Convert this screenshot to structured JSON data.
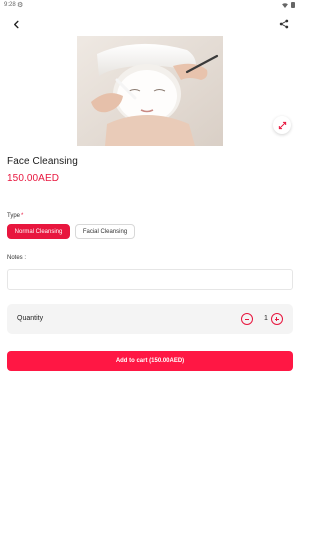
{
  "status_bar": {
    "time": "9:28",
    "icons": [
      "gear-icon",
      "wifi-icon",
      "battery-icon"
    ]
  },
  "header": {
    "back_icon": "chevron-left-icon",
    "share_icon": "share-icon"
  },
  "product": {
    "title": "Face Cleansing",
    "price": "150.00AED",
    "image_subject": "facial-treatment-photo",
    "expand_icon": "expand-arrows-icon"
  },
  "options": {
    "type_label": "Type",
    "required_marker": "*",
    "choices": [
      {
        "label": "Normal Cleansing",
        "selected": true
      },
      {
        "label": "Facial Cleansing",
        "selected": false
      }
    ]
  },
  "notes": {
    "label": "Notes :",
    "value": "",
    "placeholder": ""
  },
  "quantity": {
    "label": "Quantity",
    "value": "1"
  },
  "cta": {
    "label": "Add to cart (150.00AED)"
  },
  "colors": {
    "accent": "#e8163e",
    "button": "#ff1744",
    "card": "#f4f4f4"
  }
}
